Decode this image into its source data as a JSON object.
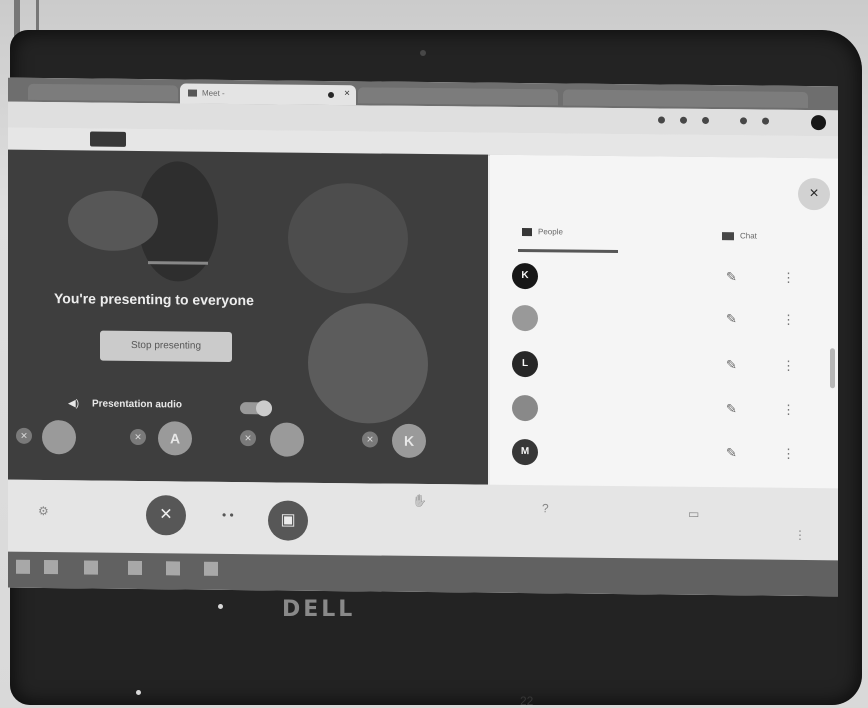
{
  "browser": {
    "active_tab": "Meet - ",
    "url": "",
    "bookmark_button": ""
  },
  "stage": {
    "top_label": "",
    "presenting_text": "You're presenting to everyone",
    "stop_button": "Stop presenting",
    "audio_label": "Presentation audio",
    "thumbnails": [
      {
        "initial": "",
        "name": ""
      },
      {
        "initial": "A",
        "name": ""
      },
      {
        "initial": "",
        "name": ""
      },
      {
        "initial": "K",
        "name": ""
      }
    ]
  },
  "panel": {
    "meeting_code": "",
    "close_label": "×",
    "people_tab": "People",
    "chat_tab": "Chat",
    "participants": [
      {
        "initial": "K",
        "name": ""
      },
      {
        "initial": "",
        "name": ""
      },
      {
        "initial": "L",
        "name": ""
      },
      {
        "initial": "",
        "name": ""
      },
      {
        "initial": "M",
        "name": ""
      }
    ]
  },
  "controls": {
    "raise_hand": "",
    "ask_questions": "",
    "stop_presenting_icon_label": ""
  },
  "brand": "DELL",
  "page_number": "22",
  "colors": {
    "stage_bg": "#3b3b3b",
    "panel_bg": "#fbfbfa",
    "bezel": "#1e1e1e"
  }
}
